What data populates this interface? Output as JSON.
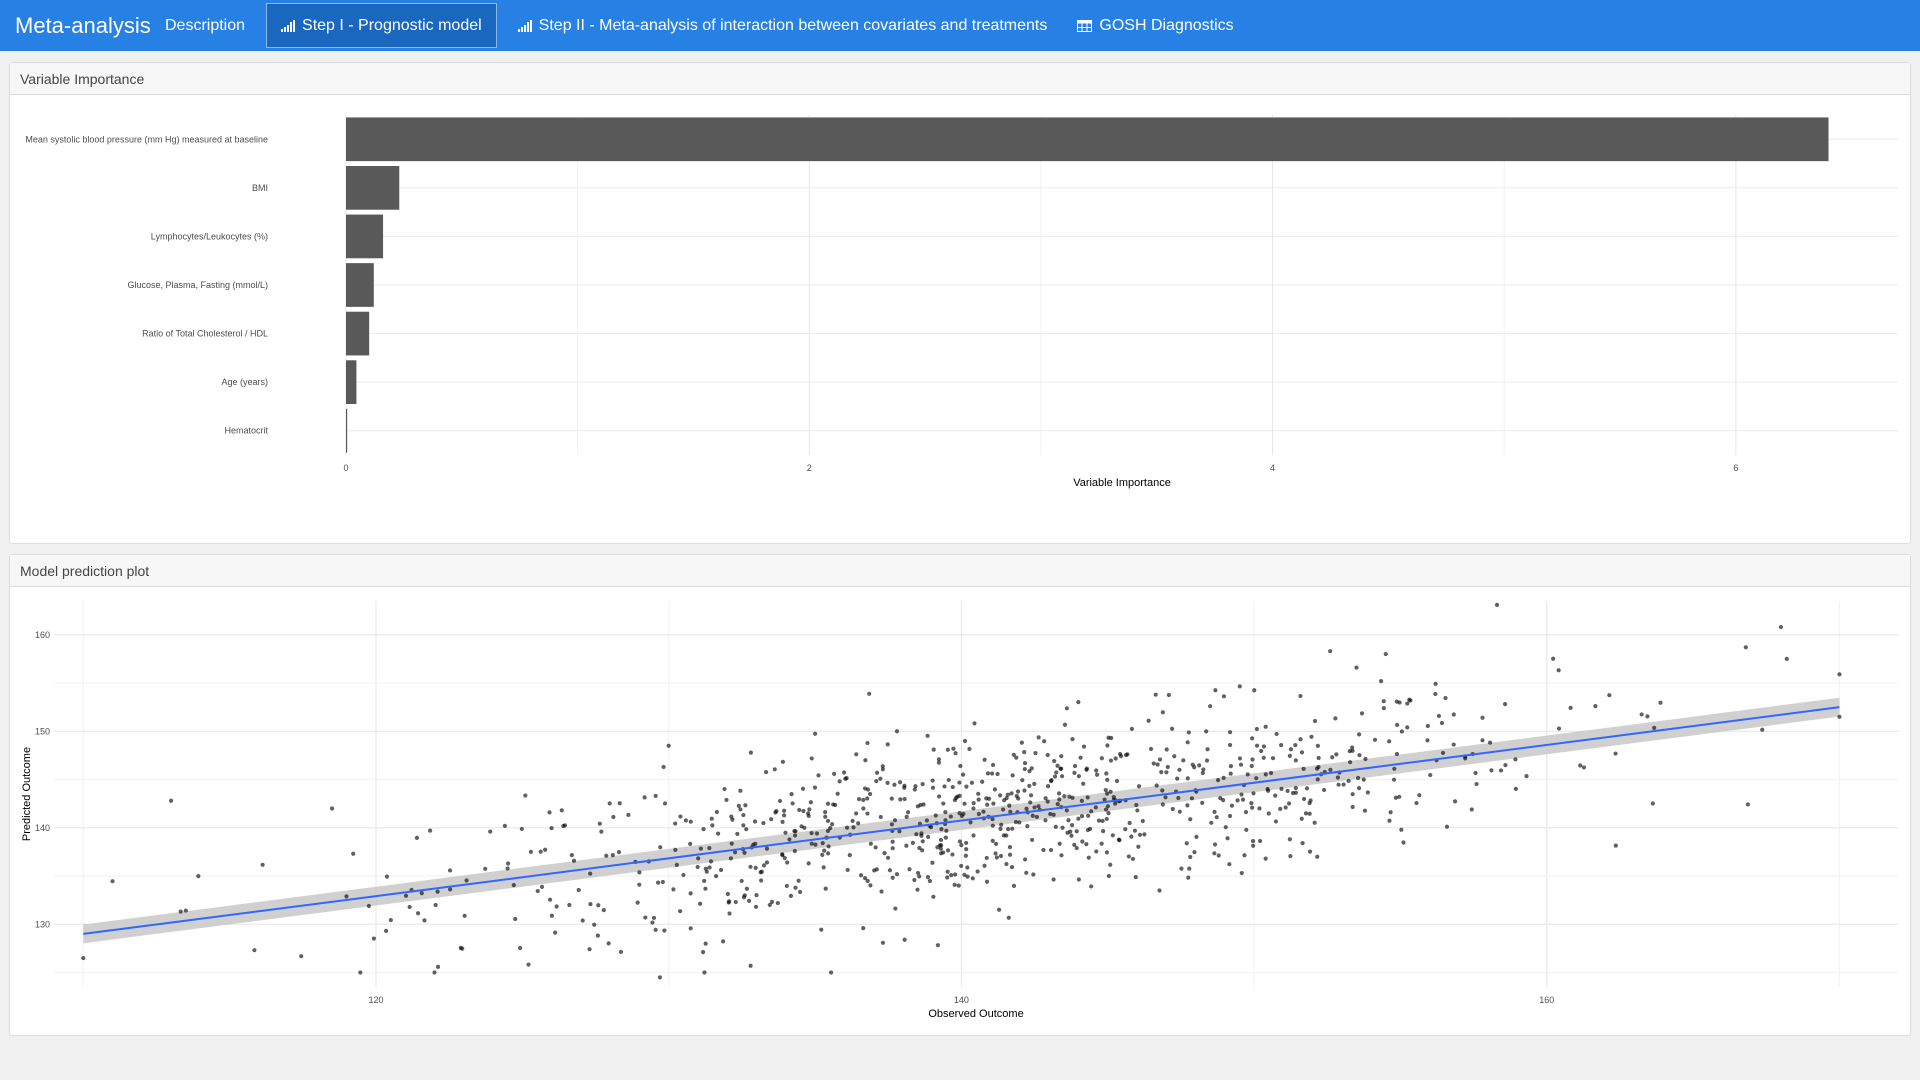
{
  "app": {
    "title": "Meta-analysis"
  },
  "nav": {
    "tabs": [
      {
        "label": "Description",
        "icon": "none",
        "active": false
      },
      {
        "label": "Step I - Prognostic model",
        "icon": "signal-bars-icon",
        "active": true
      },
      {
        "label": "Step II - Meta-analysis of interaction between covariates and treatments",
        "icon": "signal-bars-icon",
        "active": false
      },
      {
        "label": "GOSH Diagnostics",
        "icon": "table-icon",
        "active": false
      }
    ]
  },
  "panels": {
    "importance_title": "Variable Importance",
    "prediction_title": "Model prediction plot"
  },
  "colors": {
    "nav": "#2780e3",
    "bar": "#595959",
    "line": "#3366ff",
    "ribbon": "#c8c8c8"
  },
  "chart_data": [
    {
      "type": "bar",
      "orientation": "horizontal",
      "categories": [
        "Mean systolic blood pressure (mm Hg) measured at baseline",
        "BMI",
        "Lymphocytes/Leukocytes (%)",
        "Glucose, Plasma, Fasting (mmol/L)",
        "Ratio of Total Cholesterol / HDL",
        "Age (years)",
        "Hematocrit"
      ],
      "values": [
        6.4,
        0.23,
        0.16,
        0.12,
        0.1,
        0.045,
        0.005
      ],
      "xlabel": "Variable Importance",
      "xticks": [
        0,
        2,
        4,
        6
      ],
      "xlim": [
        0,
        6.7
      ],
      "grid": true
    },
    {
      "type": "scatter",
      "xlabel": "Observed Outcome",
      "ylabel": "Predicted Outcome",
      "xticks": [
        120,
        140,
        160
      ],
      "yticks": [
        130,
        140,
        150,
        160
      ],
      "xlim": [
        109,
        172
      ],
      "ylim": [
        123.5,
        163.5
      ],
      "grid": true,
      "fit_line": {
        "x": [
          110,
          170
        ],
        "y": [
          129,
          152.5
        ],
        "se_ribbon": 0.75
      },
      "highlight_points": [
        {
          "x": 110,
          "y": 126.5
        },
        {
          "x": 113,
          "y": 142.8
        },
        {
          "x": 118.5,
          "y": 142
        },
        {
          "x": 122,
          "y": 125
        },
        {
          "x": 129.7,
          "y": 124.5
        },
        {
          "x": 132.8,
          "y": 125.7
        },
        {
          "x": 158.3,
          "y": 163.1
        },
        {
          "x": 168,
          "y": 160.8
        },
        {
          "x": 152.6,
          "y": 158.3
        },
        {
          "x": 154.5,
          "y": 158
        },
        {
          "x": 166.8,
          "y": 158.7
        },
        {
          "x": 170,
          "y": 151.5
        },
        {
          "x": 153.5,
          "y": 156.6
        },
        {
          "x": 168.2,
          "y": 157.5
        },
        {
          "x": 130,
          "y": 148.5
        },
        {
          "x": 137.8,
          "y": 150
        },
        {
          "x": 148.5,
          "y": 152.6
        }
      ],
      "point_cloud": {
        "n": 860,
        "seed": 12345,
        "x_mean": 141,
        "x_sd": 9.5,
        "slope": 0.39,
        "intercept": 86.1,
        "resid_sd": 4.4
      }
    }
  ]
}
